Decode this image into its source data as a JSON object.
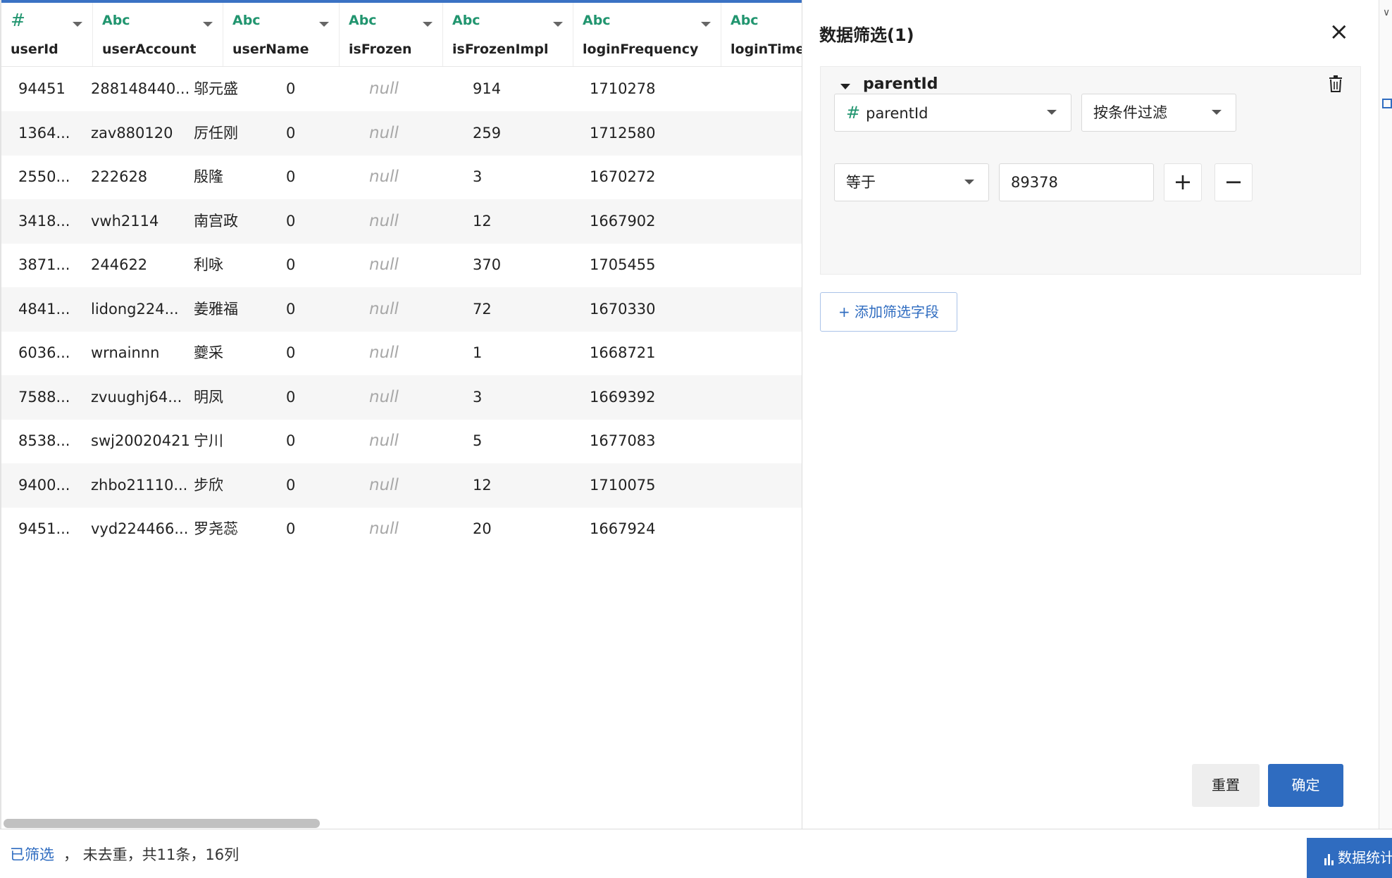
{
  "columns": [
    {
      "type": "#",
      "name": "userId"
    },
    {
      "type": "Abc",
      "name": "userAccount"
    },
    {
      "type": "Abc",
      "name": "userName"
    },
    {
      "type": "Abc",
      "name": "isFrozen"
    },
    {
      "type": "Abc",
      "name": "isFrozenImpl"
    },
    {
      "type": "Abc",
      "name": "loginFrequency"
    },
    {
      "type": "Abc",
      "name": "loginTime"
    }
  ],
  "rows": [
    [
      "94451",
      "288148440...",
      "邬元盛",
      "0",
      "null",
      "914",
      "1710278"
    ],
    [
      "1364...",
      "zav880120",
      "厉任刚",
      "0",
      "null",
      "259",
      "1712580"
    ],
    [
      "2550...",
      "222628",
      "殷隆",
      "0",
      "null",
      "3",
      "1670272"
    ],
    [
      "3418...",
      "vwh2114",
      "南宫政",
      "0",
      "null",
      "12",
      "1667902"
    ],
    [
      "3871...",
      "244622",
      "利咏",
      "0",
      "null",
      "370",
      "1705455"
    ],
    [
      "4841...",
      "lidong224...",
      "姜雅福",
      "0",
      "null",
      "72",
      "1670330"
    ],
    [
      "6036...",
      "wrnainnn",
      "夔采",
      "0",
      "null",
      "1",
      "1668721"
    ],
    [
      "7588...",
      "zvuughj64...",
      "明凤",
      "0",
      "null",
      "3",
      "1669392"
    ],
    [
      "8538...",
      "swj20020421",
      "宁川",
      "0",
      "null",
      "5",
      "1677083"
    ],
    [
      "9400...",
      "zhbo21110...",
      "步欣",
      "0",
      "null",
      "12",
      "1710075"
    ],
    [
      "9451...",
      "vyd224466...",
      "罗尧蕊",
      "0",
      "null",
      "20",
      "1667924"
    ]
  ],
  "panel": {
    "title": "数据筛选(1)",
    "close_icon": "×",
    "filter": {
      "field_label": "parentId",
      "field_select_icon": "#",
      "field_select_value": "parentId",
      "mode_select_value": "按条件过滤",
      "operator_value": "等于",
      "operand_value": "89378",
      "add_label": "+",
      "remove_label": "−"
    },
    "add_field_label": "+ 添加筛选字段",
    "reset_label": "重置",
    "confirm_label": "确定"
  },
  "footer": {
    "filtered_label": "已筛选",
    "summary": "， 未去重，共11条，16列",
    "stats_label": "数据统计"
  },
  "colors": {
    "accent": "#2f6cc0",
    "type_green": "#21956f",
    "null_gray": "#a8a8a8"
  }
}
